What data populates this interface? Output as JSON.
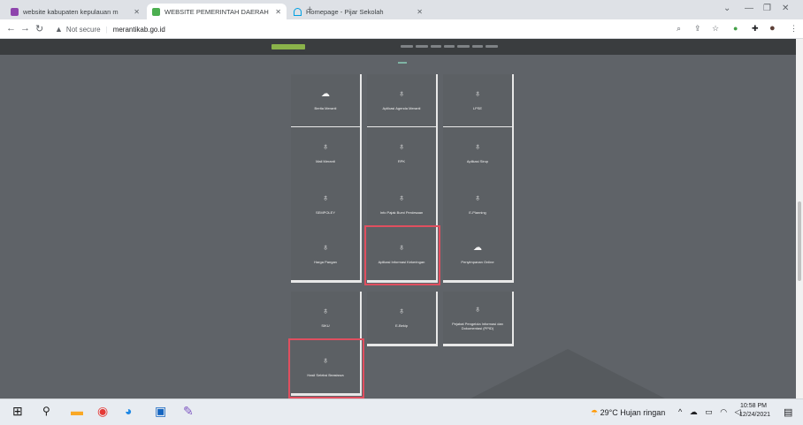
{
  "browser": {
    "tabs": [
      {
        "title": "website kabupaten kepulauan m",
        "icon": "purple-favicon-icon",
        "color": "#8e44ad"
      },
      {
        "title": "WEBSITE PEMERINTAH DAERAH",
        "icon": "green-favicon-icon",
        "color": "#4caf50"
      },
      {
        "title": "Homepage - Pijar Sekolah",
        "icon": "arc-favicon-icon",
        "color": "#00a0e3"
      }
    ],
    "new_tab_symbol": "+",
    "address": {
      "security_label": "Not secure",
      "url": "merantikab.go.id"
    }
  },
  "site": {
    "cards": [
      {
        "label": "Berita Meranti",
        "icon": "cloud-icon",
        "highlighted": false
      },
      {
        "label": "Aplikasi Agenda Meranti",
        "icon": "bulb-icon",
        "highlighted": false
      },
      {
        "label": "LPSE",
        "icon": "bulb-icon",
        "highlighted": false
      },
      {
        "label": "Mail Meranti",
        "icon": "bulb-icon",
        "highlighted": false
      },
      {
        "label": "RPK",
        "icon": "bulb-icon",
        "highlighted": false
      },
      {
        "label": "Aplikasi Sirup",
        "icon": "bulb-icon",
        "highlighted": false
      },
      {
        "label": "SEMPOLEY",
        "icon": "bulb-icon",
        "highlighted": false
      },
      {
        "label": "Info Pajak Bumi Perdesaan",
        "icon": "bulb-icon",
        "highlighted": false
      },
      {
        "label": "E-Planning",
        "icon": "bulb-icon",
        "highlighted": false
      },
      {
        "label": "Harga Pangan",
        "icon": "bulb-icon",
        "highlighted": false
      },
      {
        "label": "Aplikasi Informasi Kekeringan",
        "icon": "bulb-icon",
        "highlighted": true
      },
      {
        "label": "Penyimpanan Online",
        "icon": "cloud-outline-icon",
        "highlighted": false
      },
      {
        "label": "SIKU",
        "icon": "bulb-icon",
        "highlighted": false
      },
      {
        "label": "E-Bekip",
        "icon": "bulb-icon",
        "highlighted": false
      },
      {
        "label": "Pejabat Pengelola Informasi dan Dokumentasi (PPID)",
        "icon": "bulb-icon",
        "highlighted": false
      },
      {
        "label": "Hasil Seleksi Beasiswa",
        "icon": "bulb-icon",
        "highlighted": true
      }
    ],
    "highlight_color": "#e04f5f"
  },
  "taskbar": {
    "weather": "29°C  Hujan ringan",
    "time": "10:58 PM",
    "date": "12/24/2021"
  }
}
